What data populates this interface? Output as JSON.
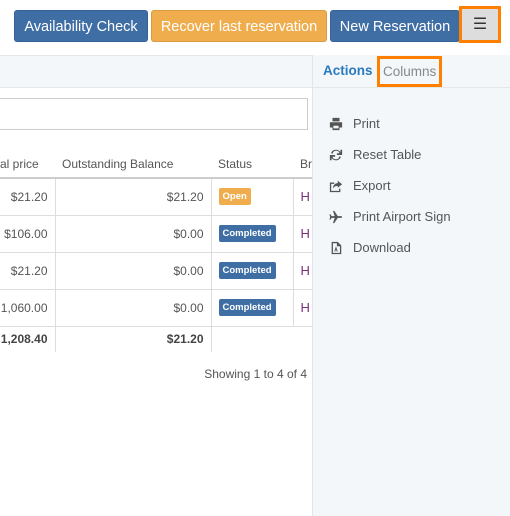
{
  "toolbar": {
    "availability": "Availability Check",
    "recover": "Recover last reservation",
    "new": "New Reservation",
    "menu_icon": "hamburger-icon"
  },
  "panel": {
    "tabs": [
      "Actions",
      "Columns"
    ],
    "items": [
      {
        "label": "Print",
        "icon": "printer-icon"
      },
      {
        "label": "Reset Table",
        "icon": "refresh-icon"
      },
      {
        "label": "Export",
        "icon": "export-icon"
      },
      {
        "label": "Print Airport Sign",
        "icon": "plane-icon"
      },
      {
        "label": "Download",
        "icon": "pdf-file-icon"
      }
    ]
  },
  "table": {
    "headers": [
      "al price",
      "Outstanding Balance",
      "Status",
      "Br"
    ],
    "rows": [
      {
        "price": "$21.20",
        "balance": "$21.20",
        "status": "Open",
        "br": "H"
      },
      {
        "price": "$106.00",
        "balance": "$0.00",
        "status": "Completed",
        "br": "H"
      },
      {
        "price": "$21.20",
        "balance": "$0.00",
        "status": "Completed",
        "br": "H"
      },
      {
        "price": "1,060.00",
        "balance": "$0.00",
        "status": "Completed",
        "br": "H"
      }
    ],
    "totals": {
      "price": "1,208.40",
      "balance": "$21.20"
    }
  },
  "colors": {
    "open": "#f0ad4e",
    "completed": "#3f6ea5"
  },
  "footer": {
    "showing": "Showing 1 to 4 of 4"
  }
}
